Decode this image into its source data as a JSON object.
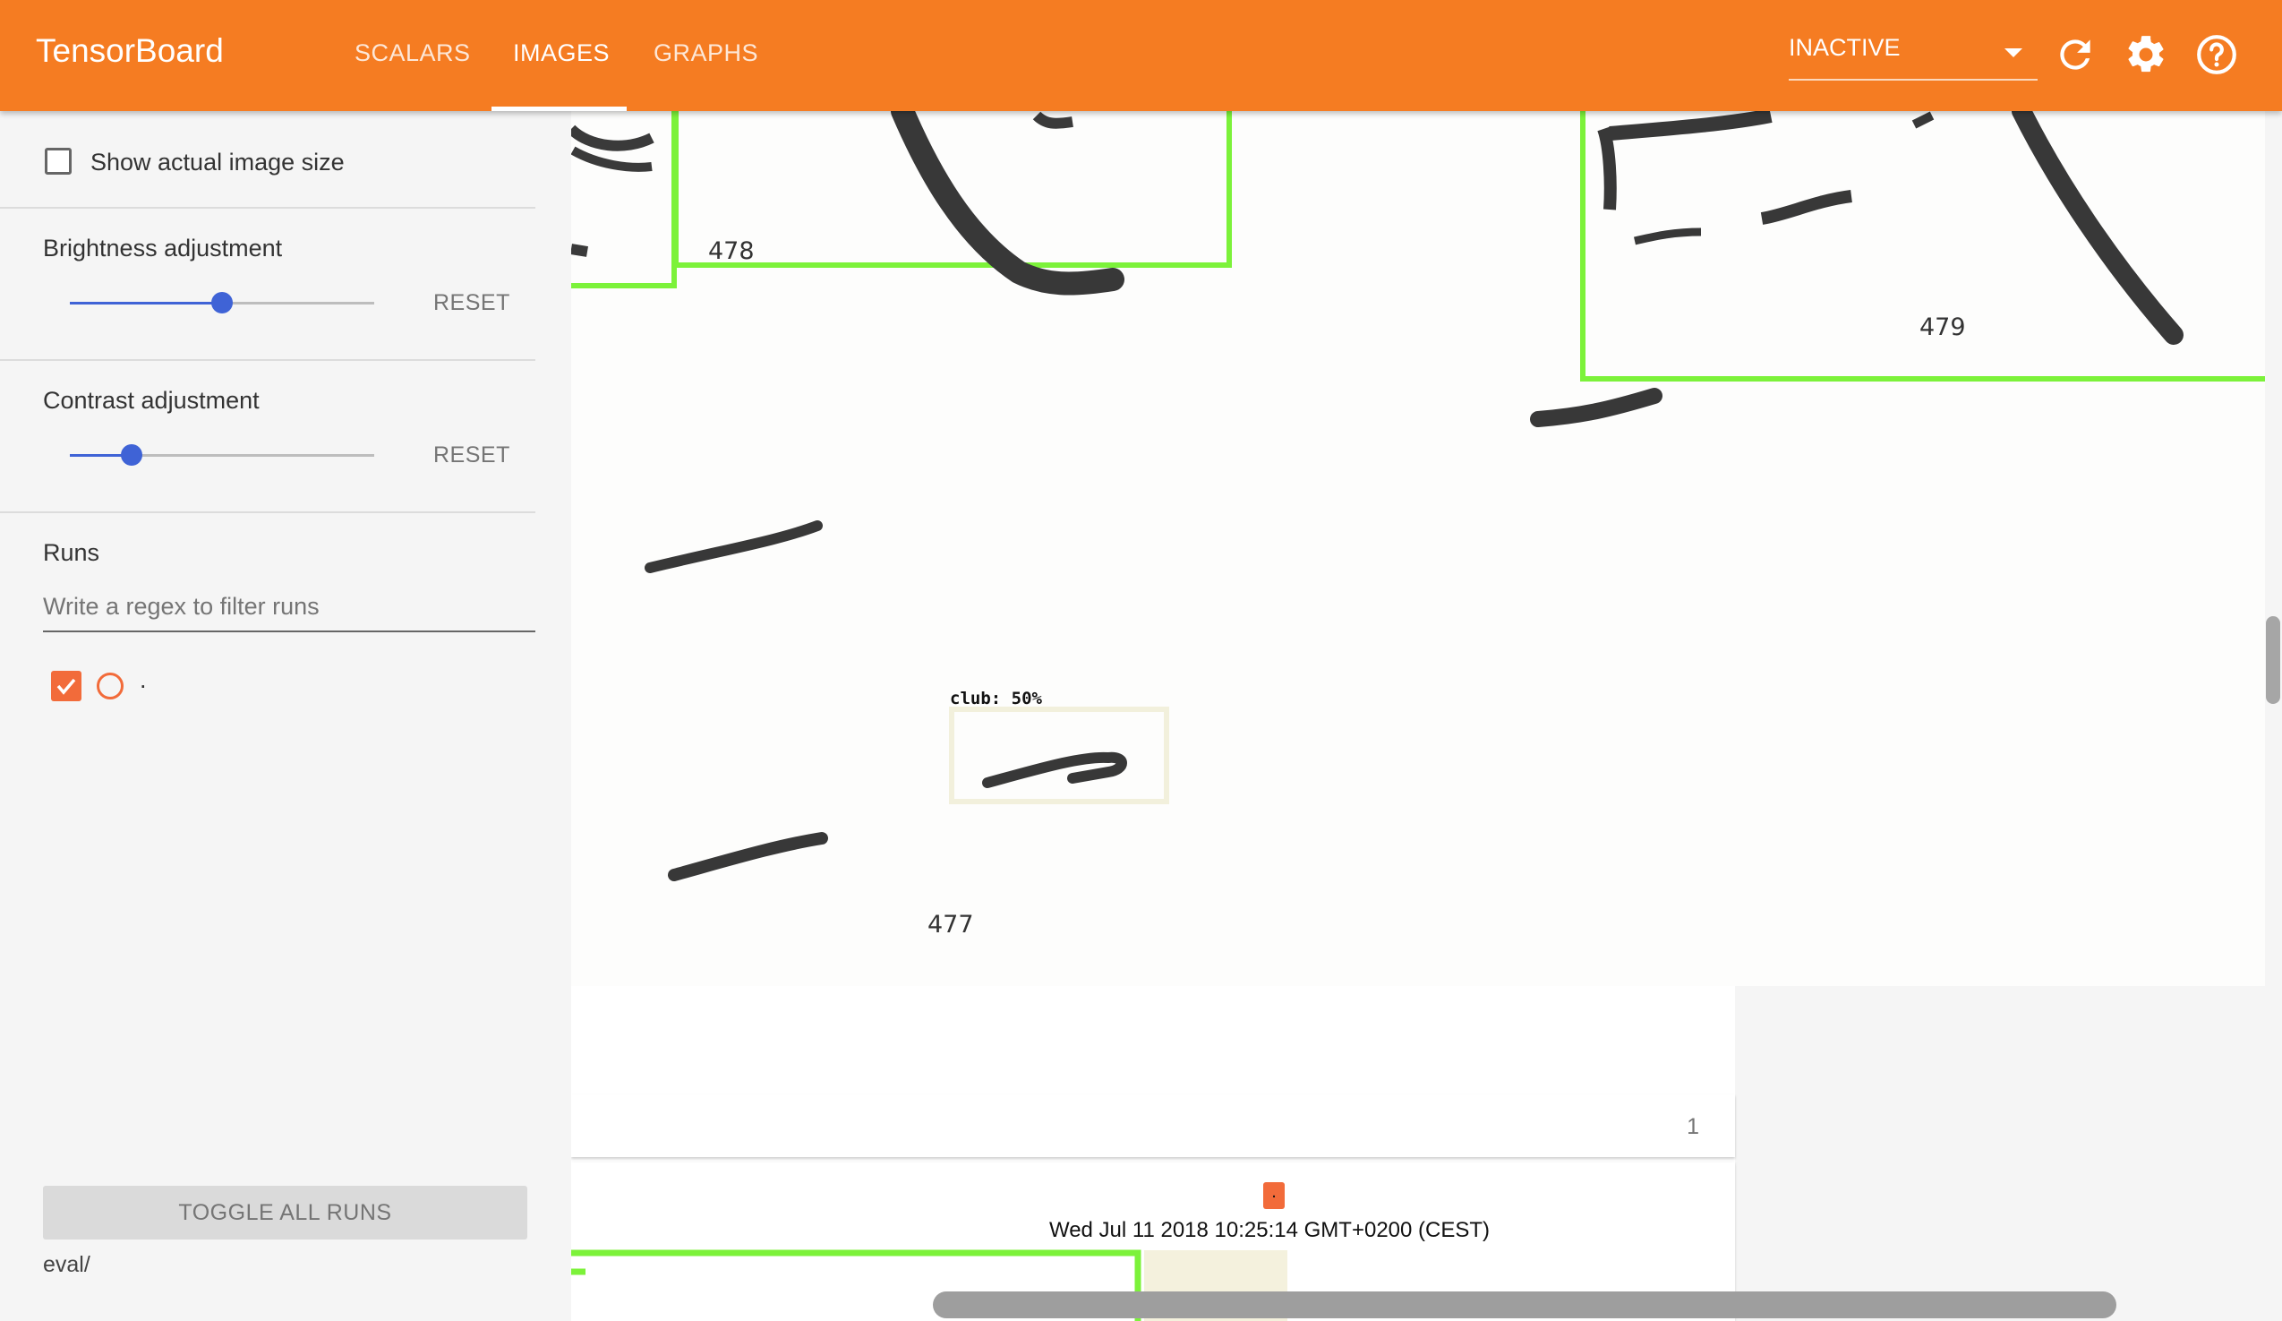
{
  "app": {
    "title": "TensorBoard",
    "tabs": [
      {
        "label": "SCALARS",
        "active": false
      },
      {
        "label": "IMAGES",
        "active": true
      },
      {
        "label": "GRAPHS",
        "active": false
      }
    ],
    "status": "INACTIVE",
    "accent_color": "#f57c22",
    "icons": [
      "refresh-icon",
      "settings-icon",
      "help-icon"
    ]
  },
  "sidebar": {
    "show_actual_size": {
      "label": "Show actual image size",
      "checked": false
    },
    "brightness": {
      "label": "Brightness adjustment",
      "reset": "RESET",
      "value_fraction": 0.5
    },
    "contrast": {
      "label": "Contrast adjustment",
      "reset": "RESET",
      "value_fraction": 0.2
    },
    "runs": {
      "title": "Runs",
      "filter_placeholder": "Write a regex to filter runs",
      "items": [
        {
          "name": ".",
          "checked": true,
          "color": "#f26b3a"
        }
      ]
    },
    "toggle_all": "TOGGLE ALL RUNS",
    "log_dir": "eval/"
  },
  "main": {
    "image": {
      "labels": {
        "n478": "478",
        "n479": "479",
        "n477": "477"
      },
      "detection": {
        "label": "club: 50%"
      },
      "box_color": "#7cf23a"
    },
    "step": {
      "value": "1"
    },
    "second_card": {
      "run_tag": ".",
      "timestamp": "Wed Jul 11 2018 10:25:14 GMT+0200 (CEST)"
    }
  }
}
